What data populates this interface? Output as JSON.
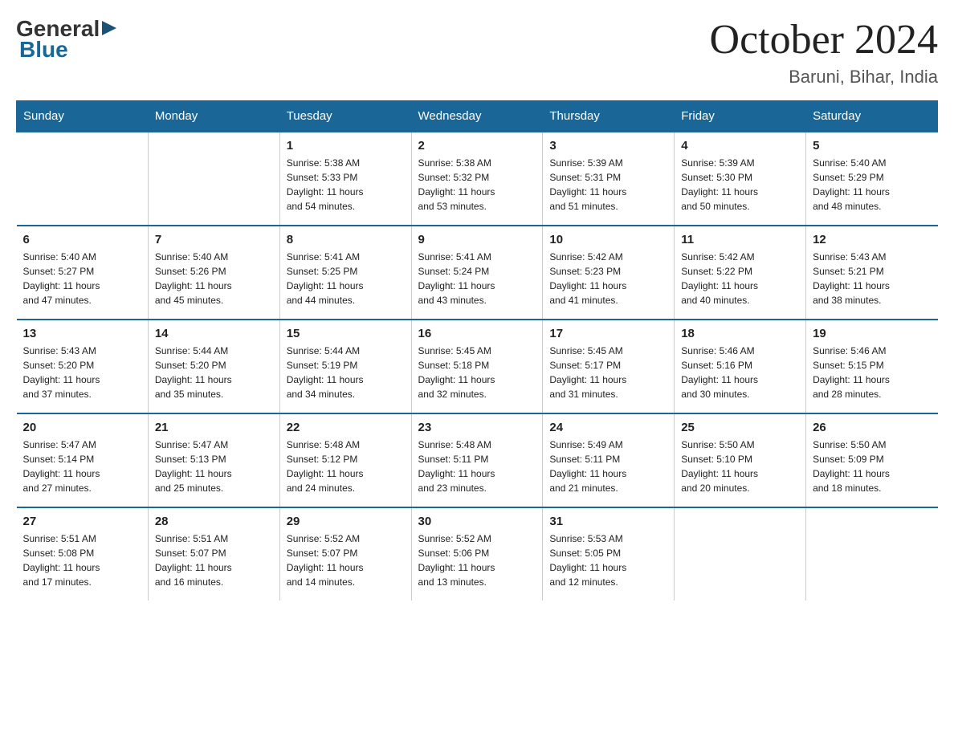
{
  "header": {
    "logo_general": "General",
    "logo_blue": "Blue",
    "month": "October 2024",
    "location": "Baruni, Bihar, India"
  },
  "days_of_week": [
    "Sunday",
    "Monday",
    "Tuesday",
    "Wednesday",
    "Thursday",
    "Friday",
    "Saturday"
  ],
  "weeks": [
    [
      {
        "day": "",
        "info": ""
      },
      {
        "day": "",
        "info": ""
      },
      {
        "day": "1",
        "info": "Sunrise: 5:38 AM\nSunset: 5:33 PM\nDaylight: 11 hours\nand 54 minutes."
      },
      {
        "day": "2",
        "info": "Sunrise: 5:38 AM\nSunset: 5:32 PM\nDaylight: 11 hours\nand 53 minutes."
      },
      {
        "day": "3",
        "info": "Sunrise: 5:39 AM\nSunset: 5:31 PM\nDaylight: 11 hours\nand 51 minutes."
      },
      {
        "day": "4",
        "info": "Sunrise: 5:39 AM\nSunset: 5:30 PM\nDaylight: 11 hours\nand 50 minutes."
      },
      {
        "day": "5",
        "info": "Sunrise: 5:40 AM\nSunset: 5:29 PM\nDaylight: 11 hours\nand 48 minutes."
      }
    ],
    [
      {
        "day": "6",
        "info": "Sunrise: 5:40 AM\nSunset: 5:27 PM\nDaylight: 11 hours\nand 47 minutes."
      },
      {
        "day": "7",
        "info": "Sunrise: 5:40 AM\nSunset: 5:26 PM\nDaylight: 11 hours\nand 45 minutes."
      },
      {
        "day": "8",
        "info": "Sunrise: 5:41 AM\nSunset: 5:25 PM\nDaylight: 11 hours\nand 44 minutes."
      },
      {
        "day": "9",
        "info": "Sunrise: 5:41 AM\nSunset: 5:24 PM\nDaylight: 11 hours\nand 43 minutes."
      },
      {
        "day": "10",
        "info": "Sunrise: 5:42 AM\nSunset: 5:23 PM\nDaylight: 11 hours\nand 41 minutes."
      },
      {
        "day": "11",
        "info": "Sunrise: 5:42 AM\nSunset: 5:22 PM\nDaylight: 11 hours\nand 40 minutes."
      },
      {
        "day": "12",
        "info": "Sunrise: 5:43 AM\nSunset: 5:21 PM\nDaylight: 11 hours\nand 38 minutes."
      }
    ],
    [
      {
        "day": "13",
        "info": "Sunrise: 5:43 AM\nSunset: 5:20 PM\nDaylight: 11 hours\nand 37 minutes."
      },
      {
        "day": "14",
        "info": "Sunrise: 5:44 AM\nSunset: 5:20 PM\nDaylight: 11 hours\nand 35 minutes."
      },
      {
        "day": "15",
        "info": "Sunrise: 5:44 AM\nSunset: 5:19 PM\nDaylight: 11 hours\nand 34 minutes."
      },
      {
        "day": "16",
        "info": "Sunrise: 5:45 AM\nSunset: 5:18 PM\nDaylight: 11 hours\nand 32 minutes."
      },
      {
        "day": "17",
        "info": "Sunrise: 5:45 AM\nSunset: 5:17 PM\nDaylight: 11 hours\nand 31 minutes."
      },
      {
        "day": "18",
        "info": "Sunrise: 5:46 AM\nSunset: 5:16 PM\nDaylight: 11 hours\nand 30 minutes."
      },
      {
        "day": "19",
        "info": "Sunrise: 5:46 AM\nSunset: 5:15 PM\nDaylight: 11 hours\nand 28 minutes."
      }
    ],
    [
      {
        "day": "20",
        "info": "Sunrise: 5:47 AM\nSunset: 5:14 PM\nDaylight: 11 hours\nand 27 minutes."
      },
      {
        "day": "21",
        "info": "Sunrise: 5:47 AM\nSunset: 5:13 PM\nDaylight: 11 hours\nand 25 minutes."
      },
      {
        "day": "22",
        "info": "Sunrise: 5:48 AM\nSunset: 5:12 PM\nDaylight: 11 hours\nand 24 minutes."
      },
      {
        "day": "23",
        "info": "Sunrise: 5:48 AM\nSunset: 5:11 PM\nDaylight: 11 hours\nand 23 minutes."
      },
      {
        "day": "24",
        "info": "Sunrise: 5:49 AM\nSunset: 5:11 PM\nDaylight: 11 hours\nand 21 minutes."
      },
      {
        "day": "25",
        "info": "Sunrise: 5:50 AM\nSunset: 5:10 PM\nDaylight: 11 hours\nand 20 minutes."
      },
      {
        "day": "26",
        "info": "Sunrise: 5:50 AM\nSunset: 5:09 PM\nDaylight: 11 hours\nand 18 minutes."
      }
    ],
    [
      {
        "day": "27",
        "info": "Sunrise: 5:51 AM\nSunset: 5:08 PM\nDaylight: 11 hours\nand 17 minutes."
      },
      {
        "day": "28",
        "info": "Sunrise: 5:51 AM\nSunset: 5:07 PM\nDaylight: 11 hours\nand 16 minutes."
      },
      {
        "day": "29",
        "info": "Sunrise: 5:52 AM\nSunset: 5:07 PM\nDaylight: 11 hours\nand 14 minutes."
      },
      {
        "day": "30",
        "info": "Sunrise: 5:52 AM\nSunset: 5:06 PM\nDaylight: 11 hours\nand 13 minutes."
      },
      {
        "day": "31",
        "info": "Sunrise: 5:53 AM\nSunset: 5:05 PM\nDaylight: 11 hours\nand 12 minutes."
      },
      {
        "day": "",
        "info": ""
      },
      {
        "day": "",
        "info": ""
      }
    ]
  ]
}
